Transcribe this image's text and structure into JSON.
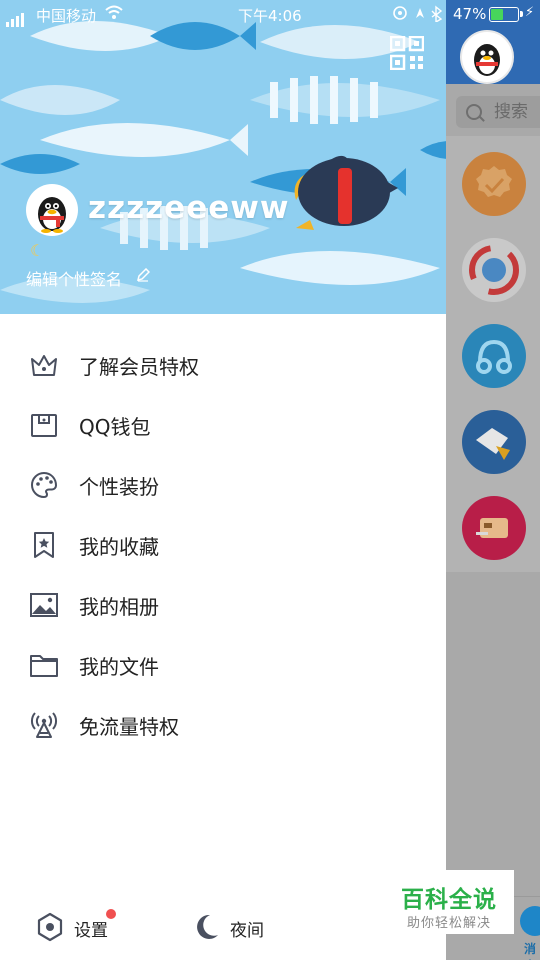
{
  "status_bar": {
    "carrier": "中国移动",
    "time": "下午4:06",
    "battery_percent": "47%",
    "battery_level": 0.47
  },
  "drawer": {
    "nickname": "zzzzeeeww",
    "signature": "编辑个性签名",
    "menu": [
      {
        "label": "了解会员特权",
        "icon": "crown-icon"
      },
      {
        "label": "QQ钱包",
        "icon": "wallet-icon"
      },
      {
        "label": "个性装扮",
        "icon": "palette-icon"
      },
      {
        "label": "我的收藏",
        "icon": "bookmark-star-icon"
      },
      {
        "label": "我的相册",
        "icon": "photo-icon"
      },
      {
        "label": "我的文件",
        "icon": "folder-icon"
      },
      {
        "label": "免流量特权",
        "icon": "broadcast-tower-icon"
      }
    ],
    "footer": {
      "settings_label": "设置",
      "night_label": "夜间"
    }
  },
  "background_app": {
    "search_placeholder": "搜索",
    "bottom_tab_label": "消息"
  },
  "watermark": {
    "title": "百科全说",
    "subtitle": "助你轻松解决"
  },
  "colors": {
    "hero_background": "#8fcff0",
    "icon_gray": "#4a5060",
    "badge_red": "#f05050",
    "watermark_green": "#2bb04a"
  }
}
